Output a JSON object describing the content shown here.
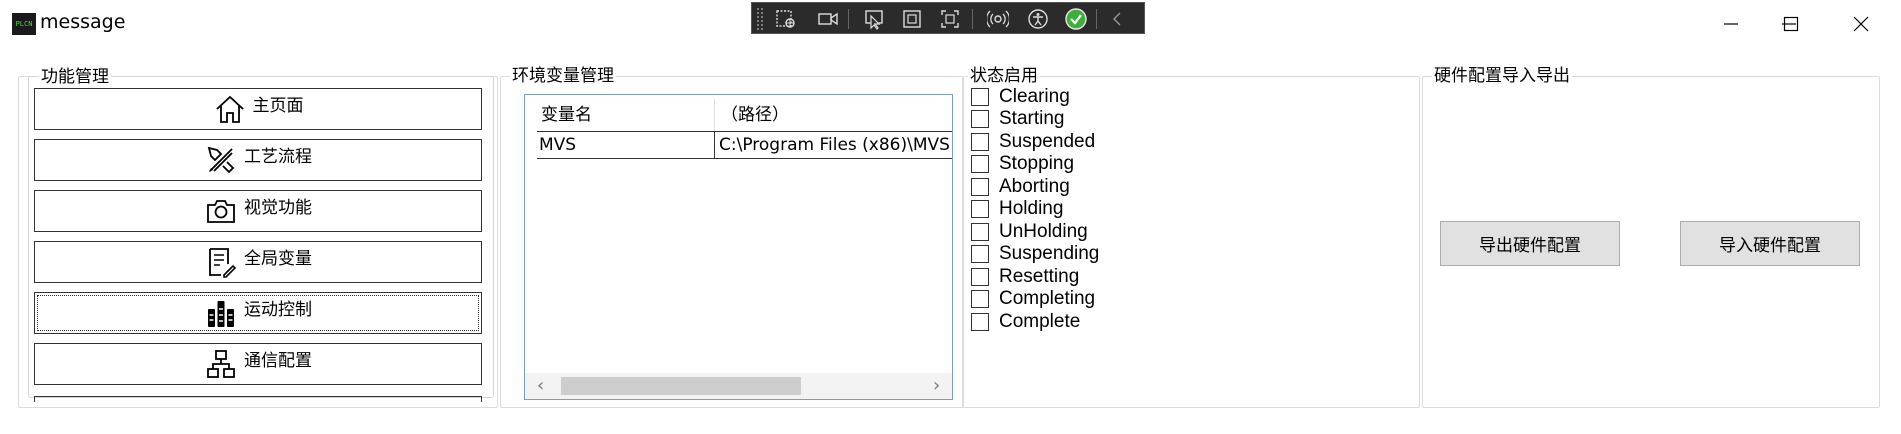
{
  "window": {
    "title": "message",
    "app_icon_text": "PLCN",
    "controls": {
      "minimize": "minimize-icon",
      "maximize": "maximize-icon",
      "close": "close-icon"
    }
  },
  "toolbar": {
    "icons": [
      "grip-icon",
      "select-region-icon",
      "video-icon",
      "pointer-icon",
      "window-capture-icon",
      "fullscreen-capture-icon",
      "broadcast-icon",
      "accessibility-icon",
      "check-circle-icon",
      "collapse-chevron-icon"
    ],
    "accent": "#3fae3f"
  },
  "function_panel": {
    "title": "功能管理",
    "buttons": [
      {
        "label": "主页面",
        "icon": "home-icon"
      },
      {
        "label": "工艺流程",
        "icon": "tools-icon"
      },
      {
        "label": "视觉功能",
        "icon": "camera-icon"
      },
      {
        "label": "全局变量",
        "icon": "document-edit-icon"
      },
      {
        "label": "运动控制",
        "icon": "motion-control-icon"
      },
      {
        "label": "通信配置",
        "icon": "network-icon"
      }
    ]
  },
  "env_panel": {
    "title": "环境变量管理",
    "columns": [
      "变量名",
      "（路径）"
    ],
    "rows": [
      {
        "name": "MVS",
        "path": "C:\\Program Files (x86)\\MVS"
      }
    ],
    "scroll_left": "‹",
    "scroll_right": "›"
  },
  "status_panel": {
    "title": "状态启用",
    "items": [
      "Clearing",
      "Starting",
      "Suspended",
      "Stopping",
      "Aborting",
      "Holding",
      "UnHolding",
      "Suspending",
      "Resetting",
      "Completing",
      "Complete"
    ]
  },
  "hardware_panel": {
    "title": "硬件配置导入导出",
    "export_label": "导出硬件配置",
    "import_label": "导入硬件配置"
  }
}
